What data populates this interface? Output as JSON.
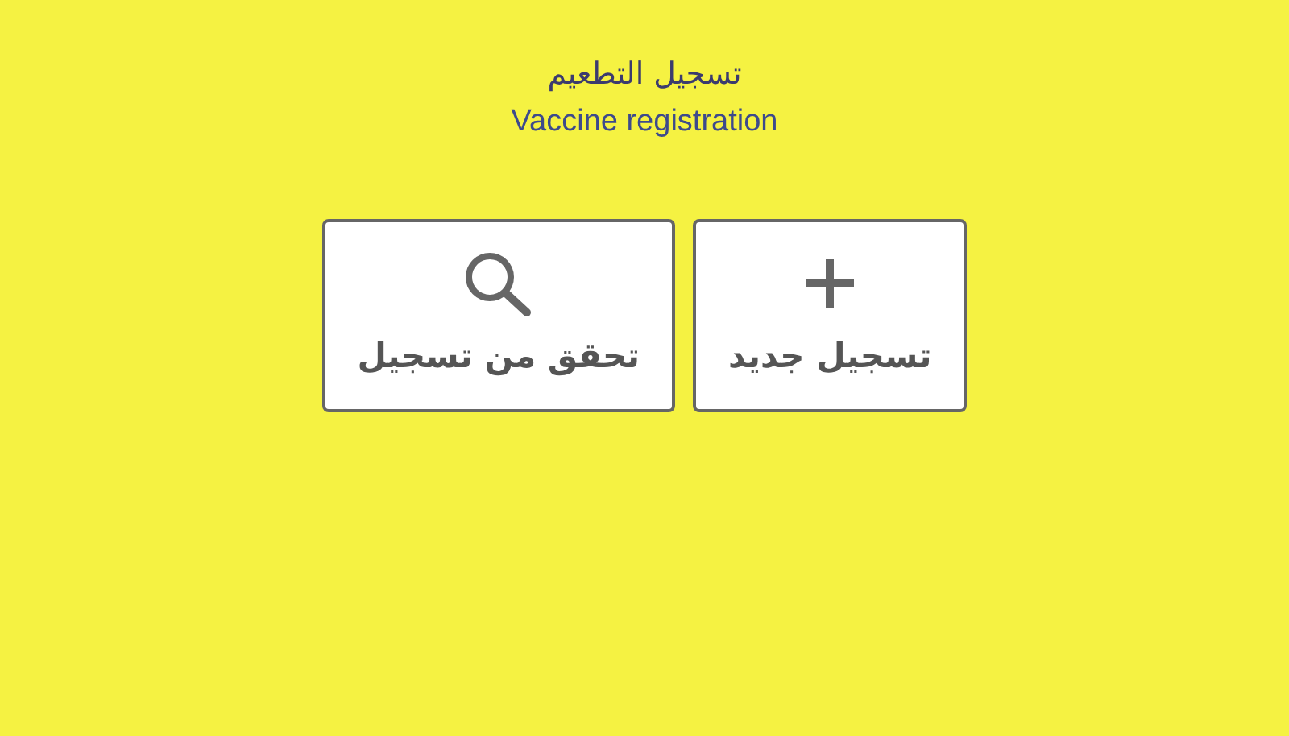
{
  "header": {
    "title": "تسجيل التطعيم",
    "subtitle": "Vaccine registration"
  },
  "buttons": [
    {
      "kind": "add",
      "label": "تسجيل جديد"
    },
    {
      "kind": "search",
      "label": "تحقق من تسجيل"
    }
  ]
}
